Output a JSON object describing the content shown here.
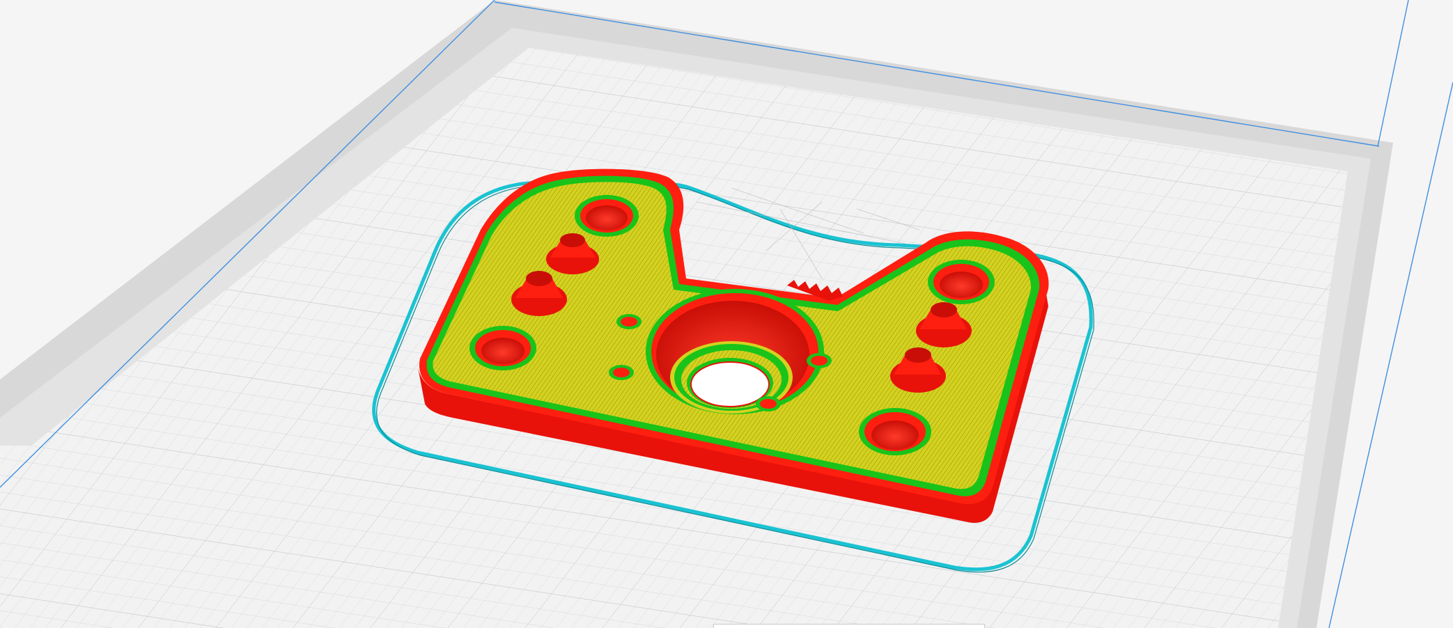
{
  "app": {
    "view": "layer-preview-3d"
  },
  "colors": {
    "background": "#f5f5f5",
    "plate_outer_gray": "#d6d6d6",
    "plate_mid_gray": "#e4e4e4",
    "plate_inner": "#f3f3f3",
    "grid_line": "#cfd4da",
    "build_volume_edge": "#3f8fe0",
    "skirt": "#19c3d2",
    "skirt_dark": "#0a8894",
    "wall_outer": "#ff1f10",
    "wall_side": "#e8120a",
    "wall_inner": "#19c31a",
    "top_infill": "#d4d21f",
    "infill_line": "#9c9a10",
    "hole_interior": "#f01a10"
  },
  "model": {
    "name": "",
    "holes": [
      {
        "kind": "counterbore",
        "label": ""
      },
      {
        "kind": "boss",
        "label": ""
      },
      {
        "kind": "boss",
        "label": ""
      },
      {
        "kind": "counterbore",
        "label": ""
      },
      {
        "kind": "counterbore",
        "label": ""
      },
      {
        "kind": "boss",
        "label": ""
      },
      {
        "kind": "boss",
        "label": ""
      },
      {
        "kind": "counterbore",
        "label": ""
      },
      {
        "kind": "center-bore",
        "label": ""
      },
      {
        "kind": "small-mount",
        "label": ""
      },
      {
        "kind": "small-mount",
        "label": ""
      },
      {
        "kind": "small-mount",
        "label": ""
      },
      {
        "kind": "small-mount",
        "label": ""
      }
    ]
  }
}
